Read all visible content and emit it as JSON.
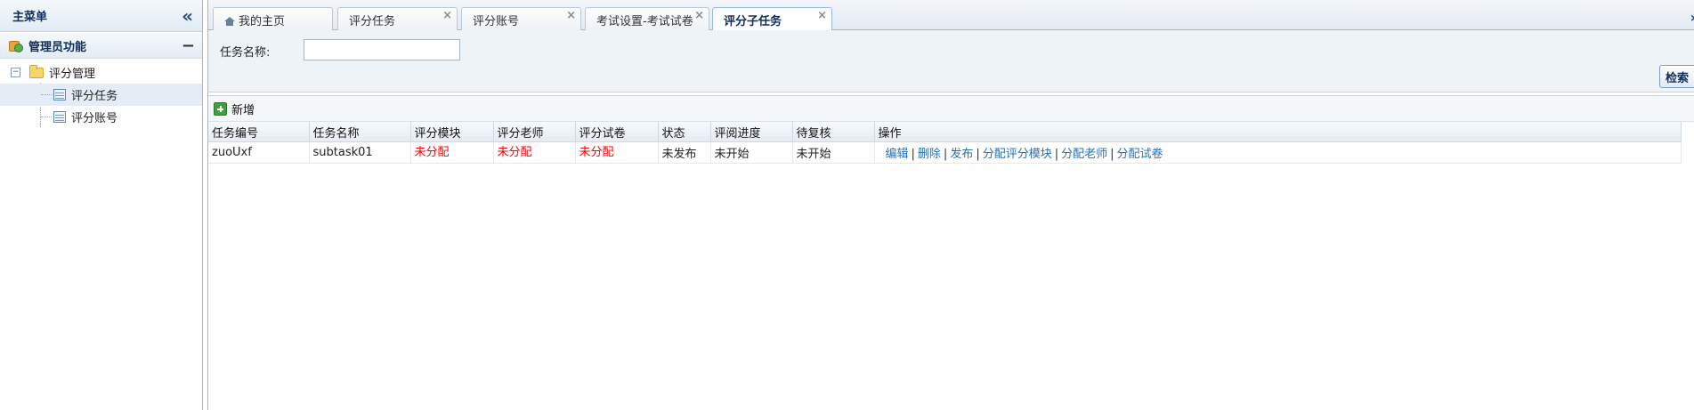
{
  "sidebar": {
    "title": "主菜单",
    "section": "管理员功能",
    "tree": {
      "group_label": "评分管理",
      "items": [
        {
          "label": "评分任务",
          "selected": true
        },
        {
          "label": "评分账号",
          "selected": false
        }
      ]
    }
  },
  "tabs": [
    {
      "label": "我的主页",
      "closable": false,
      "active": false
    },
    {
      "label": "评分任务",
      "closable": true,
      "active": false
    },
    {
      "label": "评分账号",
      "closable": true,
      "active": false
    },
    {
      "label": "考试设置-考试试卷",
      "closable": true,
      "active": false
    },
    {
      "label": "评分子任务",
      "closable": true,
      "active": true
    }
  ],
  "search": {
    "label": "任务名称:",
    "value": "",
    "placeholder": "",
    "button": "检索"
  },
  "toolbar": {
    "add_label": "新增"
  },
  "table": {
    "columns": [
      "任务编号",
      "任务名称",
      "评分模块",
      "评分老师",
      "评分试卷",
      "状态",
      "评阅进度",
      "待复核",
      "操作"
    ],
    "rows": [
      {
        "task_id": "zuoUxf",
        "task_name": "subtask01",
        "module": "未分配",
        "teacher": "未分配",
        "paper": "未分配",
        "status": "未发布",
        "progress": "未开始",
        "review": "未开始",
        "actions": [
          "编辑",
          "删除",
          "发布",
          "分配评分模块",
          "分配老师",
          "分配试卷"
        ]
      }
    ]
  },
  "colors": {
    "accent_border": "#95b8e7",
    "unassigned_text": "#ff0000",
    "link": "#2a70b8"
  }
}
